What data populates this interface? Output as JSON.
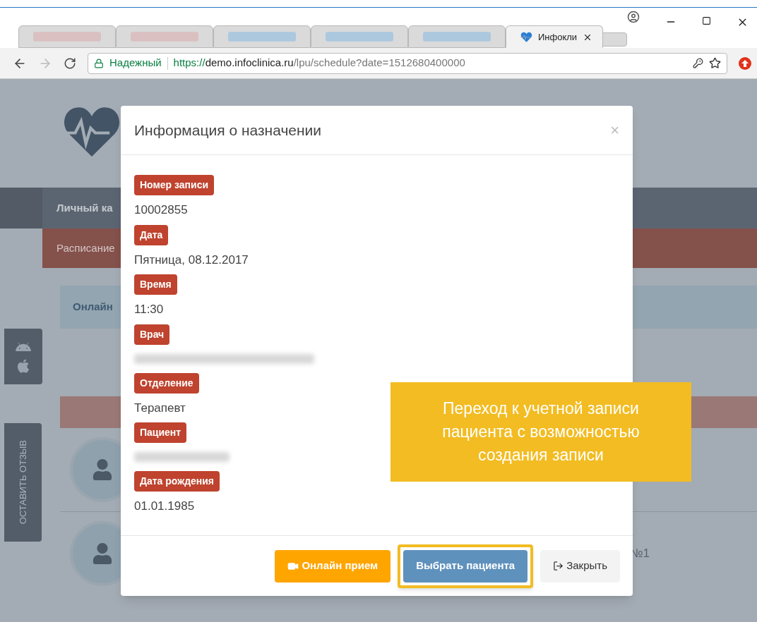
{
  "browser": {
    "tabs": [
      {
        "kind": "blurred",
        "selected": false
      },
      {
        "kind": "blurred",
        "selected": false
      },
      {
        "kind": "blurred",
        "selected": false
      },
      {
        "kind": "blurred",
        "selected": false
      },
      {
        "kind": "blurred",
        "selected": false
      },
      {
        "kind": "page",
        "title": "Инфокли",
        "selected": true
      }
    ],
    "address": {
      "security": "Надежный",
      "url_scheme": "https://",
      "url_host": "demo.infoclinica.ru",
      "url_path": "/lpu/schedule?date=1512680400000"
    }
  },
  "page": {
    "nav_title": "Личный ка",
    "subnav": "Расписание",
    "section": "Онлайн",
    "feedback_tab": "ОСТАВИТЬ ОТЗЫВ",
    "row_text": "№1"
  },
  "modal": {
    "title": "Информация о назначении",
    "close": "×",
    "fields": [
      {
        "label": "Номер записи",
        "value": "10002855",
        "redacted": false
      },
      {
        "label": "Дата",
        "value": "Пятница, 08.12.2017",
        "redacted": false
      },
      {
        "label": "Время",
        "value": "11:30",
        "redacted": false
      },
      {
        "label": "Врач",
        "redacted": true
      },
      {
        "label": "Отделение",
        "value": "Терапевт",
        "redacted": false
      },
      {
        "label": "Пациент",
        "redacted": true
      },
      {
        "label": "Дата рождения",
        "value": "01.01.1985",
        "redacted": false
      }
    ],
    "buttons": [
      {
        "kind": "video",
        "label": "Онлайн прием",
        "highlighted": false
      },
      {
        "kind": "primary",
        "label": "Выбрать пациента",
        "highlighted": true
      },
      {
        "kind": "exit",
        "label": "Закрыть",
        "highlighted": false
      }
    ]
  },
  "callout": {
    "text": "Переход к учетной записи пациента с возможностью создания записи"
  }
}
